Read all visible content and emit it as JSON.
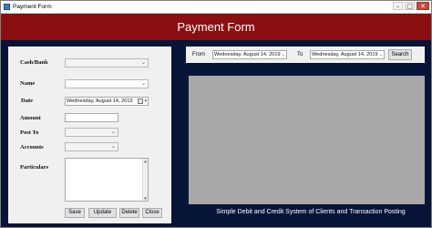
{
  "window": {
    "title": "Payment Form",
    "controls": {
      "minimize": "–",
      "maximize": "□",
      "close": "✕"
    }
  },
  "header": {
    "title": "Payment Form"
  },
  "form": {
    "labels": {
      "cash_bank": "Cash/Bank",
      "name": "Name",
      "date": "Date",
      "amount": "Amount",
      "post_to": "Post To",
      "accounts": "Accounts",
      "particulars": "Particulars"
    },
    "date_value": "Wednesday,    August    14, 2019",
    "buttons": {
      "save": "Save",
      "update": "Update",
      "delete": "Delete",
      "close": "Close"
    }
  },
  "filter": {
    "from_label": "From",
    "from_date": "Wednesday,    August    14, 2019",
    "to_label": "To",
    "to_date": "Wednesday,    August    14, 2019",
    "search_label": "Search"
  },
  "footer": {
    "text": "Simple Debit and Credit System of Clients and Transaction Posting"
  },
  "colors": {
    "header_band": "#8a0f10",
    "window_background": "#061437",
    "panel": "#f0f0f0",
    "display_area": "#a8a8a8"
  },
  "icons": {
    "dropdown": "chevron-down-icon",
    "calendar": "calendar-icon",
    "app": "app-icon"
  }
}
